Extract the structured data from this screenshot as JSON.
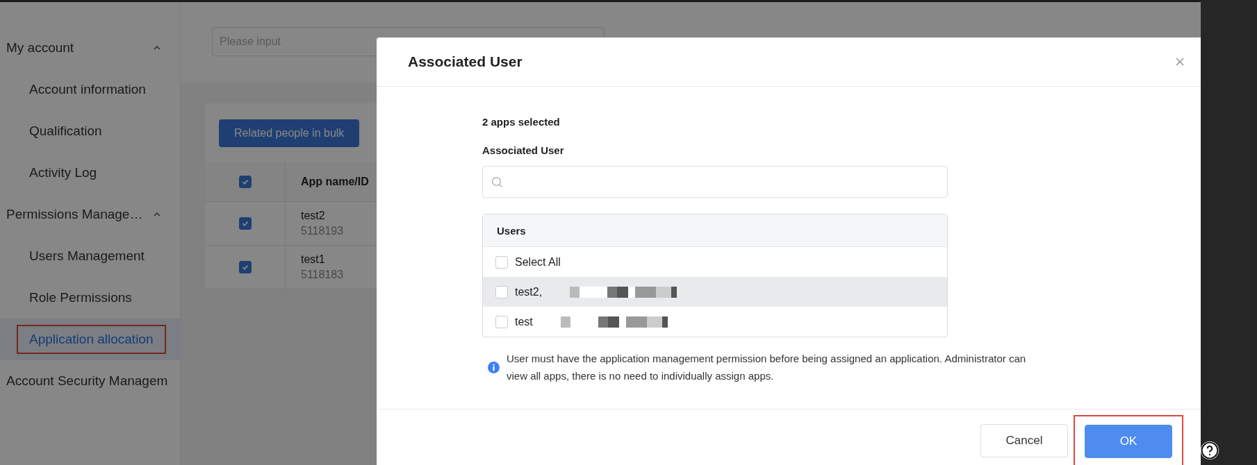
{
  "sidebar": {
    "groups": [
      {
        "label": "My account",
        "expanded": true,
        "items": [
          {
            "label": "Account information",
            "selected": false,
            "annotated": false
          },
          {
            "label": "Qualification",
            "selected": false,
            "annotated": false
          },
          {
            "label": "Activity Log",
            "selected": false,
            "annotated": false
          }
        ]
      },
      {
        "label": "Permissions Manage…",
        "expanded": true,
        "items": [
          {
            "label": "Users Management",
            "selected": false,
            "annotated": false
          },
          {
            "label": "Role Permissions",
            "selected": false,
            "annotated": false
          },
          {
            "label": "Application allocation",
            "selected": true,
            "annotated": true
          }
        ]
      },
      {
        "label": "Account Security Managem",
        "expanded": false
      }
    ]
  },
  "main": {
    "search": {
      "placeholder": "Please input"
    },
    "bulk_button": "Related people in bulk",
    "table": {
      "header": {
        "checked": true,
        "column": "App name/ID"
      },
      "rows": [
        {
          "name": "test2",
          "id": "5118193",
          "checked": true
        },
        {
          "name": "test1",
          "id": "5118183",
          "checked": true
        }
      ]
    }
  },
  "modal": {
    "title": "Associated User",
    "summary": "2 apps selected",
    "field_label": "Associated User",
    "users": {
      "header": "Users",
      "items": [
        {
          "label": "Select All",
          "checked": false,
          "highlighted": false,
          "redacted": false
        },
        {
          "label": "test2,",
          "checked": false,
          "highlighted": true,
          "redacted": true
        },
        {
          "label": "test",
          "checked": false,
          "highlighted": false,
          "redacted": true
        }
      ]
    },
    "note": "User must have the application management permission before being assigned an application. Administrator can view all apps, there is no need to individually assign apps.",
    "buttons": [
      {
        "label": "Cancel",
        "kind": "default",
        "annotated": false
      },
      {
        "label": "OK",
        "kind": "primary",
        "annotated": true
      }
    ]
  }
}
